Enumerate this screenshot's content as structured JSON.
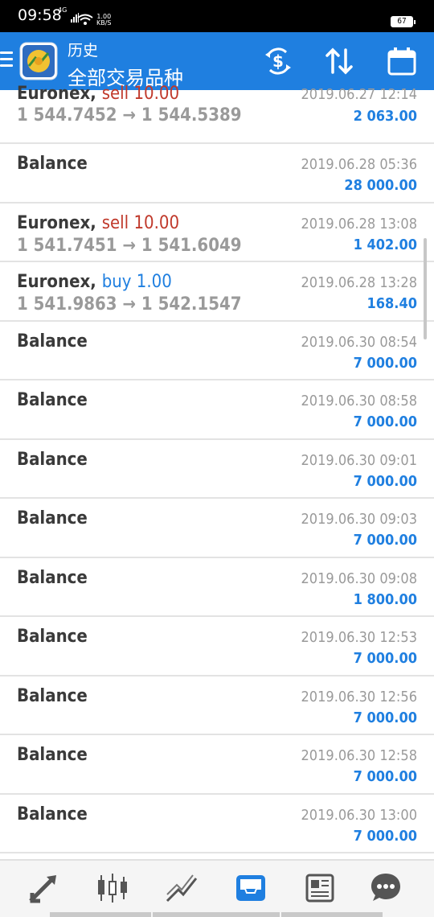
{
  "status": {
    "time": "09:58",
    "network": "4G",
    "speed_value": "1.00",
    "speed_unit": "KB/S",
    "battery": "67"
  },
  "header": {
    "title": "历史",
    "subtitle": "全部交易品种"
  },
  "icons": {
    "menu": "menu-icon",
    "app_logo": "metatrader-logo-icon",
    "currency": "currency-exchange-icon",
    "sort": "sort-icon",
    "calendar": "calendar-icon"
  },
  "colors": {
    "accent": "#1f7fe0",
    "sell": "#c0392b",
    "muted": "#9a9a9a"
  },
  "rows": [
    {
      "symbol": "Euronex,",
      "op": "sell 10.00",
      "op_type": "sell",
      "prices": "1 544.7452 → 1 544.5389",
      "time": "2019.06.27 12:14",
      "profit": "2 063.00"
    },
    {
      "symbol": "Balance",
      "op": "",
      "op_type": "",
      "prices": "",
      "time": "2019.06.28 05:36",
      "profit": "28 000.00"
    },
    {
      "symbol": "Euronex,",
      "op": "sell 10.00",
      "op_type": "sell",
      "prices": "1 541.7451 → 1 541.6049",
      "time": "2019.06.28 13:08",
      "profit": "1 402.00"
    },
    {
      "symbol": "Euronex,",
      "op": "buy 1.00",
      "op_type": "buy",
      "prices": "1 541.9863 → 1 542.1547",
      "time": "2019.06.28 13:28",
      "profit": "168.40"
    },
    {
      "symbol": "Balance",
      "op": "",
      "op_type": "",
      "prices": "",
      "time": "2019.06.30 08:54",
      "profit": "7 000.00"
    },
    {
      "symbol": "Balance",
      "op": "",
      "op_type": "",
      "prices": "",
      "time": "2019.06.30 08:58",
      "profit": "7 000.00"
    },
    {
      "symbol": "Balance",
      "op": "",
      "op_type": "",
      "prices": "",
      "time": "2019.06.30 09:01",
      "profit": "7 000.00"
    },
    {
      "symbol": "Balance",
      "op": "",
      "op_type": "",
      "prices": "",
      "time": "2019.06.30 09:03",
      "profit": "7 000.00"
    },
    {
      "symbol": "Balance",
      "op": "",
      "op_type": "",
      "prices": "",
      "time": "2019.06.30 09:08",
      "profit": "1 800.00"
    },
    {
      "symbol": "Balance",
      "op": "",
      "op_type": "",
      "prices": "",
      "time": "2019.06.30 12:53",
      "profit": "7 000.00"
    },
    {
      "symbol": "Balance",
      "op": "",
      "op_type": "",
      "prices": "",
      "time": "2019.06.30 12:56",
      "profit": "7 000.00"
    },
    {
      "symbol": "Balance",
      "op": "",
      "op_type": "",
      "prices": "",
      "time": "2019.06.30 12:58",
      "profit": "7 000.00"
    },
    {
      "symbol": "Balance",
      "op": "",
      "op_type": "",
      "prices": "",
      "time": "2019.06.30 13:00",
      "profit": "7 000.00"
    }
  ],
  "bottom_nav": [
    {
      "name": "quotes-nav",
      "icon": "arrows-updown-icon",
      "active": false
    },
    {
      "name": "chart-nav",
      "icon": "candlestick-icon",
      "active": false
    },
    {
      "name": "trade-nav",
      "icon": "trend-lines-icon",
      "active": false
    },
    {
      "name": "history-nav",
      "icon": "inbox-tray-icon",
      "active": true
    },
    {
      "name": "news-nav",
      "icon": "newspaper-icon",
      "active": false
    },
    {
      "name": "chat-nav",
      "icon": "chat-bubble-icon",
      "active": false
    }
  ]
}
